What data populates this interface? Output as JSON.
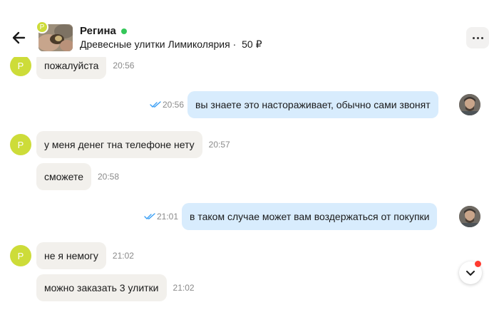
{
  "header": {
    "name": "Регина",
    "ad_title": "Древесные улитки Лимиколярия",
    "separator": "·",
    "price": "50 ₽",
    "avatar_letter": "Р",
    "online_color": "#34c759"
  },
  "icons": {
    "back": "arrow-left-icon",
    "menu": "more-horizontal-icon",
    "read": "double-check-icon",
    "scroll_down": "chevron-down-icon"
  },
  "messages": [
    {
      "direction": "in",
      "text": "пожалуйста",
      "time": "20:56",
      "avatar_letter": "Р"
    },
    {
      "direction": "out",
      "text": "вы знаете это настораживает, обычно сами звонят",
      "time": "20:56"
    },
    {
      "direction": "in",
      "text": "у меня денег тна телефоне нету",
      "time": "20:57",
      "avatar_letter": "Р"
    },
    {
      "direction": "in",
      "text": "сможете",
      "time": "20:58"
    },
    {
      "direction": "out",
      "text": "в таком случае может вам воздержаться от покупки",
      "time": "21:01"
    },
    {
      "direction": "in",
      "text": "не я немогу",
      "time": "21:02",
      "avatar_letter": "Р"
    },
    {
      "direction": "in",
      "text": "можно заказать 3 улитки",
      "time": "21:02"
    }
  ],
  "colors": {
    "in_bubble": "#f2f0ec",
    "out_bubble": "#d8ecfd",
    "avatar": "#cddc39",
    "read_check": "#3a9ff5",
    "unread_dot": "#ff3b30"
  }
}
